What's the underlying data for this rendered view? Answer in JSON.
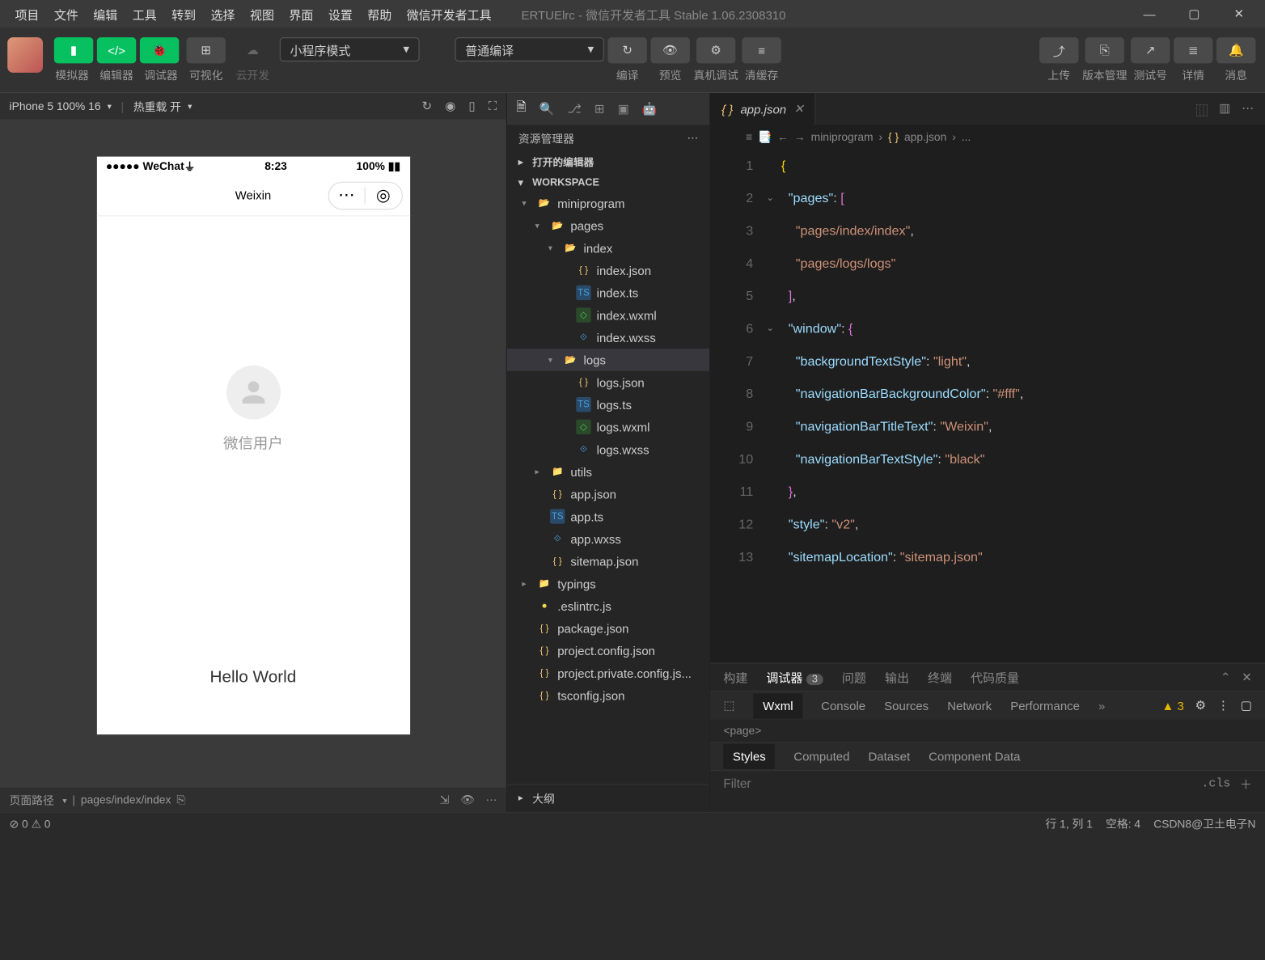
{
  "titlebar": {
    "menus": [
      "项目",
      "文件",
      "编辑",
      "工具",
      "转到",
      "选择",
      "视图",
      "界面",
      "设置",
      "帮助",
      "微信开发者工具"
    ],
    "title": "ERTUElrc - 微信开发者工具 Stable 1.06.2308310"
  },
  "toolbar": {
    "groups": [
      {
        "buttons": [
          "phone",
          "code",
          "bug"
        ],
        "labels": [
          "模拟器",
          "编辑器",
          "调试器"
        ]
      },
      {
        "buttons": [
          "visual"
        ],
        "labels": [
          "可视化"
        ]
      },
      {
        "buttons": [
          "cloud"
        ],
        "labels": [
          "云开发"
        ]
      }
    ],
    "mode_dd": "小程序模式",
    "compile_dd": "普通编译",
    "center_actions": [
      {
        "icon": "↻",
        "label": "编译"
      },
      {
        "icon": "👁",
        "label": "预览"
      },
      {
        "icon": "⚙",
        "label": "真机调试"
      },
      {
        "icon": "≡",
        "label": "清缓存"
      }
    ],
    "right_actions": [
      {
        "icon": "⤴",
        "label": "上传"
      },
      {
        "icon": "⎘",
        "label": "版本管理"
      },
      {
        "icon": "↗",
        "label": "测试号"
      },
      {
        "icon": "≣",
        "label": "详情"
      },
      {
        "icon": "🔔",
        "label": "消息"
      }
    ]
  },
  "simulator": {
    "device": "iPhone 5 100% 16",
    "reload": "热重载 开",
    "status": {
      "signal": "●●●●●",
      "carrier": "WeChat",
      "wifi": "⏚",
      "time": "8:23",
      "battery_pct": "100%"
    },
    "nav_title": "Weixin",
    "username": "微信用户",
    "hello": "Hello World",
    "footer": {
      "path_label": "页面路径",
      "path": "pages/index/index"
    }
  },
  "explorer": {
    "title": "资源管理器",
    "sections": {
      "opened": "打开的编辑器",
      "workspace": "WORKSPACE"
    },
    "tree": [
      {
        "d": 0,
        "t": "folder-open",
        "n": "miniprogram",
        "exp": true
      },
      {
        "d": 1,
        "t": "folder-open",
        "n": "pages",
        "exp": true,
        "color": "#c97"
      },
      {
        "d": 2,
        "t": "folder-open",
        "n": "index",
        "exp": true
      },
      {
        "d": 3,
        "t": "json",
        "n": "index.json"
      },
      {
        "d": 3,
        "t": "ts",
        "n": "index.ts"
      },
      {
        "d": 3,
        "t": "wxml",
        "n": "index.wxml"
      },
      {
        "d": 3,
        "t": "wxss",
        "n": "index.wxss"
      },
      {
        "d": 2,
        "t": "folder-open",
        "n": "logs",
        "exp": true,
        "sel": true
      },
      {
        "d": 3,
        "t": "json",
        "n": "logs.json"
      },
      {
        "d": 3,
        "t": "ts",
        "n": "logs.ts"
      },
      {
        "d": 3,
        "t": "wxml",
        "n": "logs.wxml"
      },
      {
        "d": 3,
        "t": "wxss",
        "n": "logs.wxss"
      },
      {
        "d": 1,
        "t": "folder",
        "n": "utils",
        "exp": false
      },
      {
        "d": 1,
        "t": "json",
        "n": "app.json"
      },
      {
        "d": 1,
        "t": "ts",
        "n": "app.ts"
      },
      {
        "d": 1,
        "t": "wxss",
        "n": "app.wxss"
      },
      {
        "d": 1,
        "t": "json",
        "n": "sitemap.json"
      },
      {
        "d": 0,
        "t": "folder",
        "n": "typings",
        "exp": false
      },
      {
        "d": 0,
        "t": "js",
        "n": ".eslintrc.js"
      },
      {
        "d": 0,
        "t": "json",
        "n": "package.json",
        "color": "#7a7"
      },
      {
        "d": 0,
        "t": "json",
        "n": "project.config.json"
      },
      {
        "d": 0,
        "t": "json",
        "n": "project.private.config.js..."
      },
      {
        "d": 0,
        "t": "json",
        "n": "tsconfig.json"
      }
    ],
    "outline": "大纲"
  },
  "editor": {
    "tab_file": "app.json",
    "breadcrumb": [
      "miniprogram",
      "app.json",
      "..."
    ],
    "lines": [
      {
        "n": 1,
        "fold": "",
        "html": "<span class='s-brace'>{</span>"
      },
      {
        "n": 2,
        "fold": "⌄",
        "html": "  <span class='s-key'>\"pages\"</span><span class='s-punc'>: </span><span class='s-br2'>[</span>"
      },
      {
        "n": 3,
        "fold": "",
        "html": "    <span class='s-str'>\"pages/index/index\"</span><span class='s-punc'>,</span>"
      },
      {
        "n": 4,
        "fold": "",
        "html": "    <span class='s-str'>\"pages/logs/logs\"</span>"
      },
      {
        "n": 5,
        "fold": "",
        "html": "  <span class='s-br2'>]</span><span class='s-punc'>,</span>"
      },
      {
        "n": 6,
        "fold": "⌄",
        "html": "  <span class='s-key'>\"window\"</span><span class='s-punc'>: </span><span class='s-br2'>{</span>"
      },
      {
        "n": 7,
        "fold": "",
        "html": "    <span class='s-key'>\"backgroundTextStyle\"</span><span class='s-punc'>: </span><span class='s-str'>\"light\"</span><span class='s-punc'>,</span>"
      },
      {
        "n": 8,
        "fold": "",
        "html": "    <span class='s-key'>\"navigationBarBackgroundColor\"</span><span class='s-punc'>: </span><span class='s-str'>\"#fff\"</span><span class='s-punc'>,</span>"
      },
      {
        "n": 9,
        "fold": "",
        "html": "    <span class='s-key'>\"navigationBarTitleText\"</span><span class='s-punc'>: </span><span class='s-str'>\"Weixin\"</span><span class='s-punc'>,</span>"
      },
      {
        "n": 10,
        "fold": "",
        "html": "    <span class='s-key'>\"navigationBarTextStyle\"</span><span class='s-punc'>: </span><span class='s-str'>\"black\"</span>"
      },
      {
        "n": 11,
        "fold": "",
        "html": "  <span class='s-br2'>}</span><span class='s-punc'>,</span>"
      },
      {
        "n": 12,
        "fold": "",
        "html": "  <span class='s-key'>\"style\"</span><span class='s-punc'>: </span><span class='s-str'>\"v2\"</span><span class='s-punc'>,</span>"
      },
      {
        "n": 13,
        "fold": "",
        "html": "  <span class='s-key'>\"sitemapLocation\"</span><span class='s-punc'>: </span><span class='s-str'>\"sitemap.json\"</span>"
      }
    ]
  },
  "devtools": {
    "top_tabs": [
      "构建",
      "调试器",
      "问题",
      "输出",
      "终端",
      "代码质量"
    ],
    "top_active": 1,
    "badge": "3",
    "sub_tabs": [
      "Wxml",
      "Console",
      "Sources",
      "Network",
      "Performance"
    ],
    "sub_active": 0,
    "warn_count": "3",
    "element": "<page>",
    "style_tabs": [
      "Styles",
      "Computed",
      "Dataset",
      "Component Data"
    ],
    "filter_ph": "Filter",
    "cls": ".cls"
  },
  "statusbar": {
    "left": [
      "⊘ 0 ⚠ 0"
    ],
    "right": [
      "行 1, 列 1",
      "空格: 4",
      "CSDN8@卫土电子N"
    ]
  }
}
